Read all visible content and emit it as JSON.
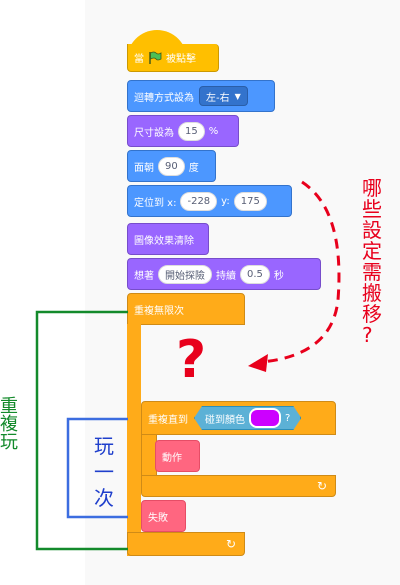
{
  "blocks": {
    "when_flag": {
      "prefix": "當",
      "suffix": "被點擊"
    },
    "rotation": {
      "label": "迴轉方式設為",
      "value": "左-右"
    },
    "size": {
      "label": "尺寸設為",
      "value": "15",
      "unit": "%"
    },
    "direction": {
      "label": "面朝",
      "value": "90",
      "unit": "度"
    },
    "goto": {
      "label": "定位到 x:",
      "x": "-228",
      "ylabel": "y:",
      "y": "175"
    },
    "clear_effects": {
      "label": "圖像效果清除"
    },
    "think": {
      "label": "想著",
      "text": "開始探險",
      "mid": "持續",
      "secs": "0.5",
      "unit": "秒"
    },
    "forever": {
      "label": "重複無限次"
    },
    "repeat_until": {
      "label": "重複直到",
      "sensing": "碰到顏色",
      "question": "?"
    },
    "action": {
      "label": "動作"
    },
    "fail": {
      "label": "失敗"
    }
  },
  "annotations": {
    "missing_marker": "?",
    "repeat_once": [
      "玩",
      "一",
      "次"
    ],
    "repeat_play": [
      "重",
      "複",
      "玩"
    ],
    "which_settings": [
      "哪",
      "些",
      "設",
      "定",
      "需",
      "搬",
      "移",
      "?"
    ]
  },
  "colors": {
    "events": "#ffbf00",
    "motion": "#4c97ff",
    "looks": "#9966ff",
    "control": "#ffab19",
    "custom": "#ff6680",
    "touch_color": "#cc00ff"
  }
}
